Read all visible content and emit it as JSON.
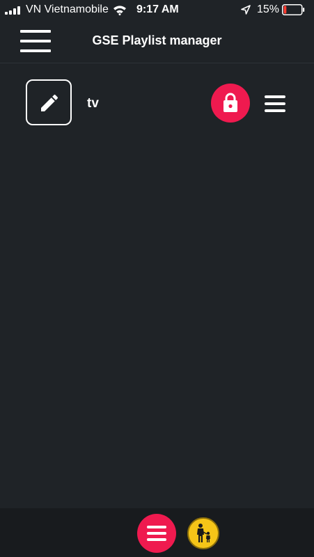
{
  "status_bar": {
    "carrier": "VN Vietnamobile",
    "time": "9:17 AM",
    "battery_percent": "15%",
    "battery_level": 0.15,
    "icons": [
      "signal-icon",
      "wifi-icon",
      "location-arrow-icon",
      "battery-icon"
    ]
  },
  "header": {
    "title": "GSE Playlist manager",
    "menu_icon": "hamburger-icon"
  },
  "playlists": [
    {
      "name": "tv",
      "locked": true,
      "edit_icon": "pencil-icon",
      "lock_icon": "lock-icon",
      "menu_icon": "hamburger-icon"
    }
  ],
  "bottom_bar": {
    "menu_icon": "hamburger-icon",
    "parental_icon": "parent-child-icon"
  },
  "colors": {
    "background": "#1f2327",
    "accent": "#ef1a4f",
    "parental": "#f5c518",
    "bottom_bar": "#181b1e"
  }
}
